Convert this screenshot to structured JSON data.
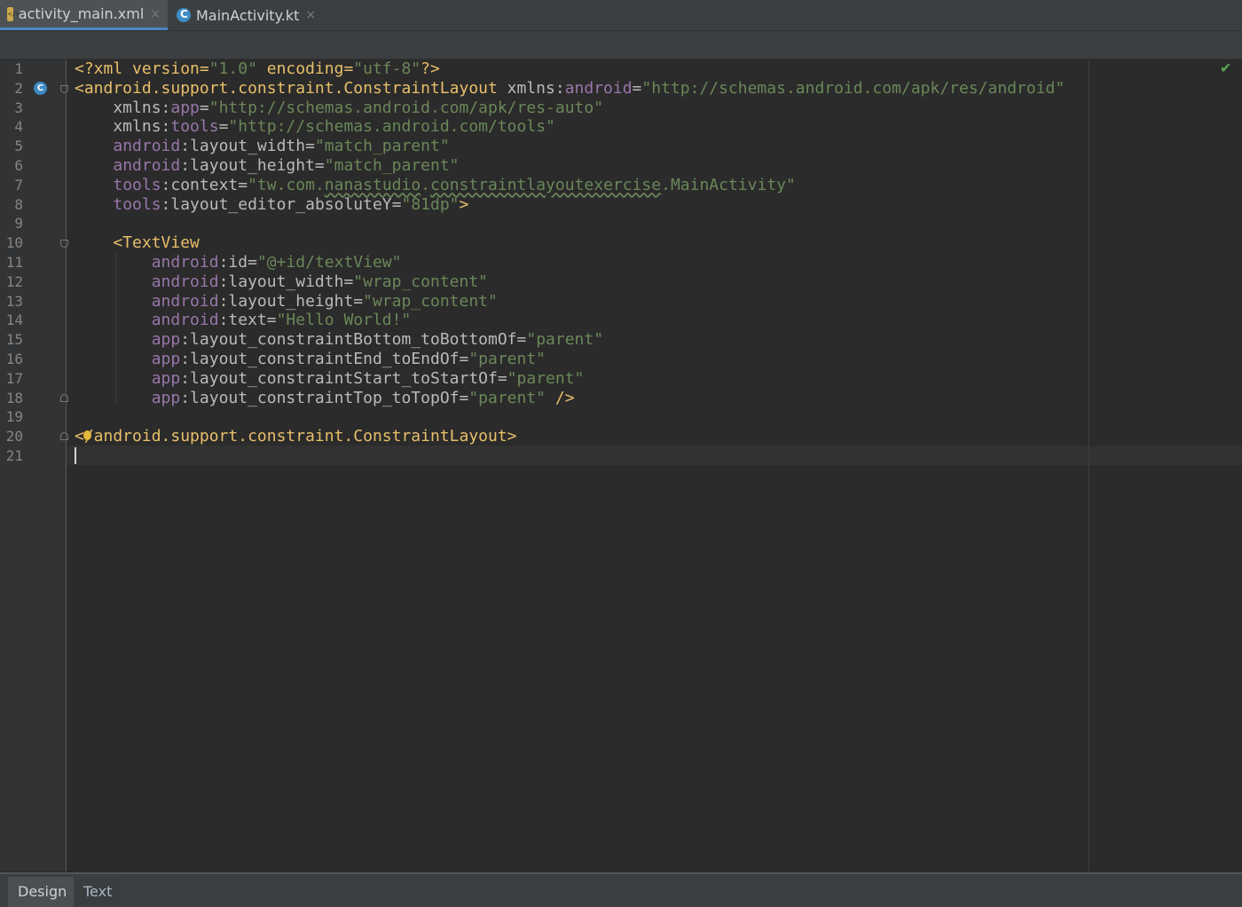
{
  "tabs": [
    {
      "label": "activity_main.xml",
      "icon": "xml-file-icon",
      "active": true
    },
    {
      "label": "MainActivity.kt",
      "icon": "kotlin-class-icon",
      "active": false
    }
  ],
  "tab_close_glyph": "×",
  "gutter_icon": "C",
  "status_check": "✔",
  "line_numbers": [
    "1",
    "2",
    "3",
    "4",
    "5",
    "6",
    "7",
    "8",
    "9",
    "10",
    "11",
    "12",
    "13",
    "14",
    "15",
    "16",
    "17",
    "18",
    "19",
    "20",
    "21"
  ],
  "code_lines": [
    [
      {
        "t": "<?xml version=",
        "c": "tag"
      },
      {
        "t": "\"1.0\"",
        "c": "str"
      },
      {
        "t": " encoding=",
        "c": "tag"
      },
      {
        "t": "\"utf-8\"",
        "c": "str"
      },
      {
        "t": "?>",
        "c": "tag"
      }
    ],
    [
      {
        "t": "<android.support.constraint.ConstraintLayout",
        "c": "tag"
      },
      {
        "t": " xmlns:",
        "c": "attr"
      },
      {
        "t": "android",
        "c": "ns"
      },
      {
        "t": "=",
        "c": "attr"
      },
      {
        "t": "\"http://schemas.android.com/apk/res/android\"",
        "c": "str"
      }
    ],
    [
      {
        "t": "    xmlns:",
        "c": "attr"
      },
      {
        "t": "app",
        "c": "ns"
      },
      {
        "t": "=",
        "c": "attr"
      },
      {
        "t": "\"http://schemas.android.com/apk/res-auto\"",
        "c": "str"
      }
    ],
    [
      {
        "t": "    xmlns:",
        "c": "attr"
      },
      {
        "t": "tools",
        "c": "ns"
      },
      {
        "t": "=",
        "c": "attr"
      },
      {
        "t": "\"http://schemas.android.com/tools\"",
        "c": "str"
      }
    ],
    [
      {
        "t": "    ",
        "c": "attr"
      },
      {
        "t": "android",
        "c": "ns"
      },
      {
        "t": ":layout_width=",
        "c": "attr"
      },
      {
        "t": "\"match_parent\"",
        "c": "str"
      }
    ],
    [
      {
        "t": "    ",
        "c": "attr"
      },
      {
        "t": "android",
        "c": "ns"
      },
      {
        "t": ":layout_height=",
        "c": "attr"
      },
      {
        "t": "\"match_parent\"",
        "c": "str"
      }
    ],
    [
      {
        "t": "    ",
        "c": "attr"
      },
      {
        "t": "tools",
        "c": "ns"
      },
      {
        "t": ":context=",
        "c": "attr"
      },
      {
        "t": "\"tw.com.",
        "c": "str"
      },
      {
        "t": "nanastudio",
        "c": "str typo"
      },
      {
        "t": ".",
        "c": "str"
      },
      {
        "t": "constraintlayoutexercise",
        "c": "str typo"
      },
      {
        "t": ".MainActivity\"",
        "c": "str"
      }
    ],
    [
      {
        "t": "    ",
        "c": "attr"
      },
      {
        "t": "tools",
        "c": "ns"
      },
      {
        "t": ":layout_editor_absoluteY=",
        "c": "attr"
      },
      {
        "t": "\"81dp\"",
        "c": "str"
      },
      {
        "t": ">",
        "c": "tag"
      }
    ],
    [],
    [
      {
        "t": "    <TextView",
        "c": "tag"
      }
    ],
    [
      {
        "t": "        ",
        "c": "attr"
      },
      {
        "t": "android",
        "c": "ns"
      },
      {
        "t": ":id=",
        "c": "attr"
      },
      {
        "t": "\"@+id/textView\"",
        "c": "str"
      }
    ],
    [
      {
        "t": "        ",
        "c": "attr"
      },
      {
        "t": "android",
        "c": "ns"
      },
      {
        "t": ":layout_width=",
        "c": "attr"
      },
      {
        "t": "\"wrap_content\"",
        "c": "str"
      }
    ],
    [
      {
        "t": "        ",
        "c": "attr"
      },
      {
        "t": "android",
        "c": "ns"
      },
      {
        "t": ":layout_height=",
        "c": "attr"
      },
      {
        "t": "\"wrap_content\"",
        "c": "str"
      }
    ],
    [
      {
        "t": "        ",
        "c": "attr"
      },
      {
        "t": "android",
        "c": "ns"
      },
      {
        "t": ":text=",
        "c": "attr"
      },
      {
        "t": "\"Hello World!\"",
        "c": "str"
      }
    ],
    [
      {
        "t": "        ",
        "c": "attr"
      },
      {
        "t": "app",
        "c": "ns"
      },
      {
        "t": ":layout_constraintBottom_toBottomOf=",
        "c": "attr"
      },
      {
        "t": "\"parent\"",
        "c": "str"
      }
    ],
    [
      {
        "t": "        ",
        "c": "attr"
      },
      {
        "t": "app",
        "c": "ns"
      },
      {
        "t": ":layout_constraintEnd_toEndOf=",
        "c": "attr"
      },
      {
        "t": "\"parent\"",
        "c": "str"
      }
    ],
    [
      {
        "t": "        ",
        "c": "attr"
      },
      {
        "t": "app",
        "c": "ns"
      },
      {
        "t": ":layout_constraintStart_toStartOf=",
        "c": "attr"
      },
      {
        "t": "\"parent\"",
        "c": "str"
      }
    ],
    [
      {
        "t": "        ",
        "c": "attr"
      },
      {
        "t": "app",
        "c": "ns"
      },
      {
        "t": ":layout_constraintTop_toTopOf=",
        "c": "attr"
      },
      {
        "t": "\"parent\"",
        "c": "str"
      },
      {
        "t": " />",
        "c": "tag"
      }
    ],
    [],
    [
      {
        "t": "</android.support.constraint.ConstraintLayout>",
        "c": "tag"
      }
    ],
    []
  ],
  "bottom_tabs": [
    {
      "label": "Design"
    },
    {
      "label": "Text"
    }
  ],
  "colors": {
    "tag": "#e8bf6a",
    "attr": "#bababa",
    "namespace": "#9876aa",
    "string": "#6a8759",
    "active_tab_underline": "#4a88c7"
  }
}
